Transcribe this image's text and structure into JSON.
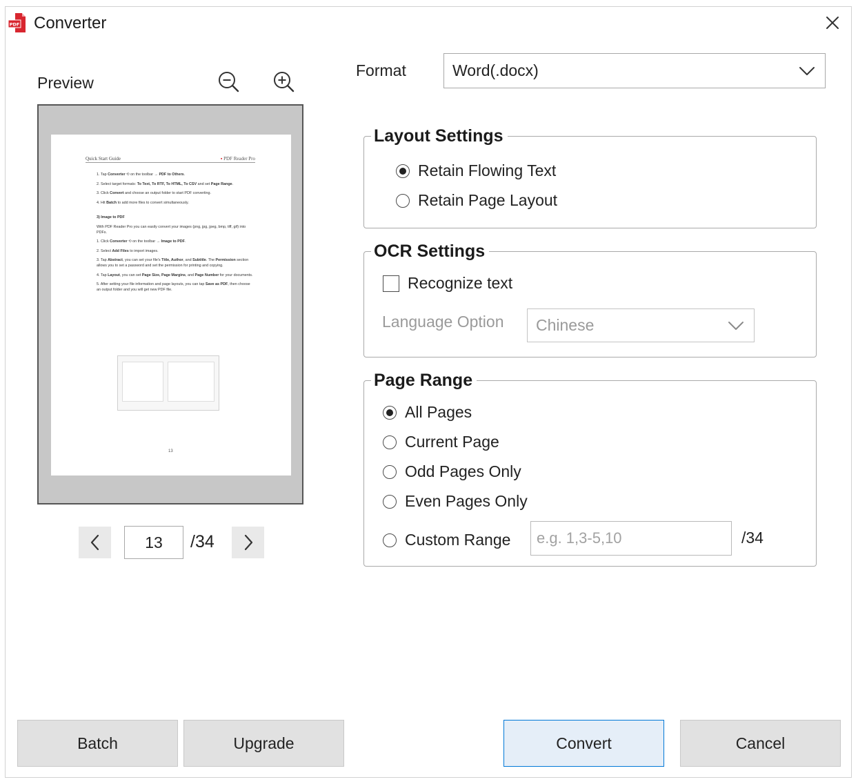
{
  "window": {
    "title": "Converter",
    "icon": "pdf-app-icon",
    "close_icon": "close-icon"
  },
  "preview": {
    "label": "Preview",
    "zoom_out_icon": "zoom-out-icon",
    "zoom_in_icon": "zoom-in-icon",
    "current_page": "13",
    "total_pages": "/34",
    "prev_icon": "chevron-left-icon",
    "next_icon": "chevron-right-icon"
  },
  "format": {
    "label": "Format",
    "selected": "Word(.docx)"
  },
  "layout_settings": {
    "legend": "Layout Settings",
    "options": [
      {
        "label": "Retain Flowing Text",
        "selected": true
      },
      {
        "label": "Retain Page Layout",
        "selected": false
      }
    ]
  },
  "ocr_settings": {
    "legend": "OCR Settings",
    "recognize_label": "Recognize text",
    "recognize_checked": false,
    "language_label": "Language Option",
    "language_selected": "Chinese"
  },
  "page_range": {
    "legend": "Page Range",
    "options": [
      {
        "label": "All Pages",
        "selected": true
      },
      {
        "label": "Current Page",
        "selected": false
      },
      {
        "label": "Odd Pages Only",
        "selected": false
      },
      {
        "label": "Even Pages Only",
        "selected": false
      },
      {
        "label": "Custom Range",
        "selected": false
      }
    ],
    "custom_placeholder": "e.g. 1,3-5,10",
    "custom_total": "/34"
  },
  "buttons": {
    "batch": "Batch",
    "upgrade": "Upgrade",
    "convert": "Convert",
    "cancel": "Cancel"
  },
  "colors": {
    "accent": "#0078d7",
    "brand_red": "#d8262f",
    "button_bg": "#e1e1e1"
  }
}
